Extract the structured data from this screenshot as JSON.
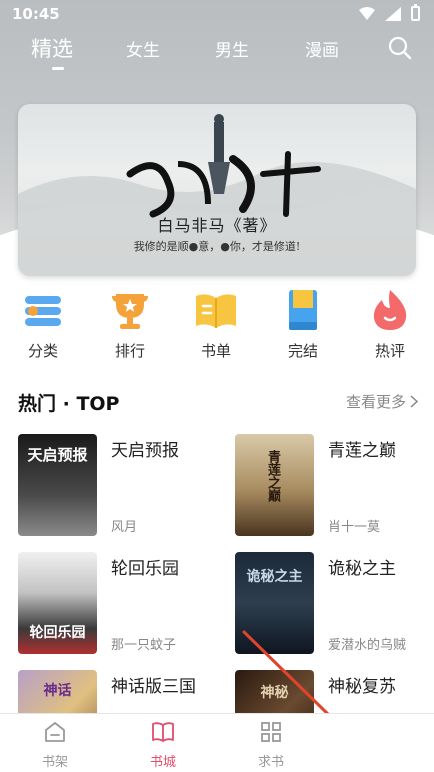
{
  "status_bar": {
    "time": "10:45"
  },
  "top_tabs": [
    {
      "label": "精选",
      "active": true
    },
    {
      "label": "女生",
      "active": false
    },
    {
      "label": "男生",
      "active": false
    },
    {
      "label": "漫画",
      "active": false
    }
  ],
  "banner": {
    "calligraphy": "天下山",
    "title": "白马非马《著》",
    "subtitle": "我修的是顺●意，●你，才是修道!"
  },
  "categories": [
    {
      "label": "分类",
      "icon": "category-icon"
    },
    {
      "label": "排行",
      "icon": "trophy-icon"
    },
    {
      "label": "书单",
      "icon": "book-list-icon"
    },
    {
      "label": "完结",
      "icon": "finished-icon"
    },
    {
      "label": "热评",
      "icon": "flame-icon"
    }
  ],
  "section": {
    "title": "热门 · TOP",
    "more_label": "查看更多"
  },
  "books": [
    {
      "title": "天启预报",
      "author": "风月",
      "cover_text": "天启预报"
    },
    {
      "title": "青莲之巅",
      "author": "肖十一莫",
      "cover_text": "青莲之巅"
    },
    {
      "title": "轮回乐园",
      "author": "那一只蚊子",
      "cover_text": "轮回乐园"
    },
    {
      "title": "诡秘之主",
      "author": "爱潜水的乌贼",
      "cover_text": "诡秘之主"
    },
    {
      "title": "神话版三国",
      "author": "",
      "cover_text": "神话"
    },
    {
      "title": "神秘复苏",
      "author": "",
      "cover_text": "神秘"
    }
  ],
  "bottom_nav": [
    {
      "label": "书架",
      "icon": "bookshelf-icon",
      "active": false
    },
    {
      "label": "书城",
      "icon": "book-store-icon",
      "active": true
    },
    {
      "label": "求书",
      "icon": "grid-icon",
      "active": false
    }
  ],
  "colors": {
    "accent": "#e14d6e",
    "annotation_arrow": "#e0442c"
  }
}
